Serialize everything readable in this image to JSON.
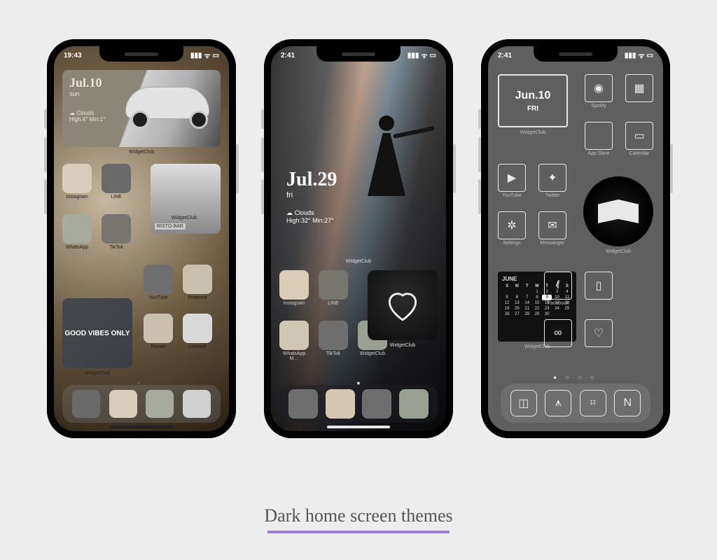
{
  "caption": "Dark home screen themes",
  "phones": {
    "p1": {
      "time": "19:43",
      "widget": {
        "date": "Jul.10",
        "day": "sun",
        "weather": "☁ Clouds",
        "temps": "High:4° Min:1°",
        "label": "WidgetClub"
      },
      "good_vibes": "GOOD VIBES ONLY",
      "good_vibes_label": "WidgetClub",
      "risto": "RISTO-BAR",
      "icons": {
        "r1": [
          "Instagram",
          "LINE"
        ],
        "r2": [
          "WhatsApp",
          "TikTok",
          "WidgetClub"
        ],
        "r3_right": [
          "YouTube",
          "Pinterest"
        ],
        "r4_right": [
          "Picsart",
          "Lemon8"
        ]
      },
      "palette": {
        "a": "#d8cdbb",
        "b": "#6a6a6a",
        "c": "#a7ab9f",
        "d": "#75746e",
        "e": "#c9c0ae",
        "f": "#d9d9d9"
      },
      "dock": [
        "#6a6a6a",
        "#d8cdbb",
        "#a7ab9f",
        "#cfcfcf"
      ]
    },
    "p2": {
      "time": "2:41",
      "widget": {
        "date": "Jul.29",
        "day": "fri",
        "weather": "☁ Clouds",
        "temps": "High:32° Min:27°",
        "label": "WidgetClub"
      },
      "heart_label": "WidgetClub",
      "icons": {
        "r1": [
          "Instagram",
          "LINE"
        ],
        "r2": [
          "WhatsApp M…",
          "TikTok",
          "WidgetClub"
        ]
      },
      "palette": {
        "a": "#d9cdb8",
        "b": "#76766f",
        "c": "#cfc6b3",
        "d": "#6e6e6e",
        "e": "#9aa193"
      },
      "dock": [
        "#6e6e6e",
        "#d4c7b0",
        "#6e6e6e",
        "#9aa193"
      ]
    },
    "p3": {
      "time": "2:41",
      "date_widget": {
        "date": "Jun.10",
        "day": "FRI",
        "label": "WidgetClub"
      },
      "book_label": "WidgetClub",
      "cal": {
        "month": "JUNE",
        "head": [
          "S",
          "M",
          "T",
          "W",
          "T",
          "F",
          "S"
        ],
        "rows": [
          [
            "",
            "",
            "",
            "1",
            "2",
            "3",
            "4"
          ],
          [
            "5",
            "6",
            "7",
            "8",
            "9",
            "10",
            "11"
          ],
          [
            "12",
            "13",
            "14",
            "15",
            "16",
            "17",
            "18"
          ],
          [
            "19",
            "20",
            "21",
            "22",
            "23",
            "24",
            "25"
          ],
          [
            "26",
            "27",
            "28",
            "29",
            "30",
            "",
            ""
          ]
        ],
        "today": "9",
        "label": "WidgetClub"
      },
      "icons": {
        "r1": [
          {
            "n": "Spotify",
            "g": "◉"
          },
          {
            "n": "",
            "g": "▦"
          }
        ],
        "r2": [
          {
            "n": "App Store",
            "g": ""
          },
          {
            "n": "Calendar",
            "g": "▭"
          }
        ],
        "r3": [
          {
            "n": "YouTube",
            "g": "▶"
          },
          {
            "n": "Twitter",
            "g": "✦"
          }
        ],
        "r4": [
          {
            "n": "Settings",
            "g": "✲"
          },
          {
            "n": "Messanger",
            "g": "✉"
          }
        ],
        "r5": [
          {
            "n": "Facebook",
            "g": "f"
          },
          {
            "n": "",
            "g": "▯"
          }
        ],
        "r6": [
          {
            "n": "",
            "g": "∞"
          },
          {
            "n": "",
            "g": "♡"
          }
        ]
      },
      "dock": [
        "◫",
        "⩚",
        "⌗",
        "N"
      ]
    }
  }
}
